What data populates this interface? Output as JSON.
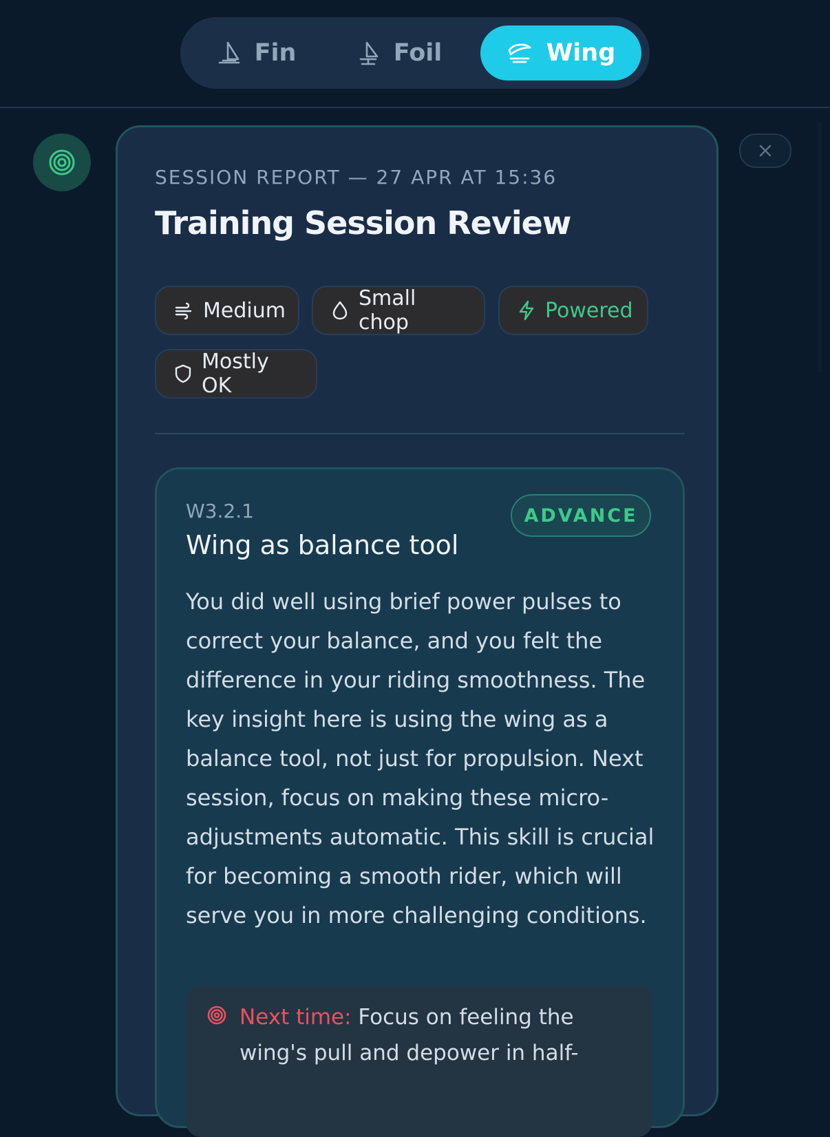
{
  "tabs": [
    {
      "label": "Fin",
      "icon": "sail-icon",
      "active": false
    },
    {
      "label": "Foil",
      "icon": "foil-sail-icon",
      "active": false
    },
    {
      "label": "Wing",
      "icon": "wing-icon",
      "active": true
    }
  ],
  "report": {
    "meta": "SESSION REPORT — 27 APR AT 15:36",
    "title": "Training Session Review"
  },
  "chips": [
    {
      "label": "Medium",
      "icon": "wind-icon"
    },
    {
      "label": "Small chop",
      "icon": "droplet-icon"
    },
    {
      "label": "Powered",
      "icon": "lightning-icon",
      "color": "#3ec98a"
    },
    {
      "label": "Mostly OK",
      "icon": "shield-icon"
    }
  ],
  "lesson": {
    "code": "W3.2.1",
    "title": "Wing as balance tool",
    "badge": "ADVANCE",
    "body": "You did well using brief power pulses to correct your balance, and you felt the difference in your riding smoothness. The key insight here is using the wing as a balance tool, not just for propulsion. Next session, focus on making these micro-adjustments automatic. This skill is crucial for becoming a smooth rider, which will serve you in more challenging conditions.",
    "next_label": "Next time:",
    "next_text": "Focus on feeling the wing's pull and depower in half-"
  },
  "colors": {
    "accent": "#1ecbe8",
    "green": "#3ec98a",
    "red": "#ef4f5e",
    "background": "#0b1a2b",
    "card": "#1a2d47"
  }
}
